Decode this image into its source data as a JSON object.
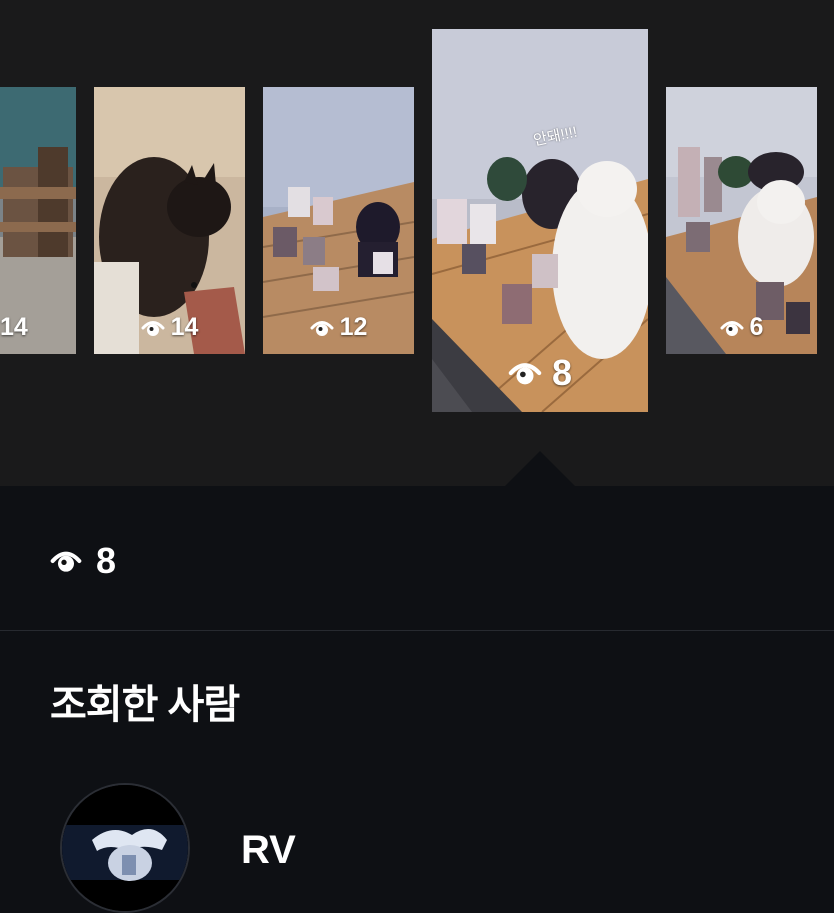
{
  "stories": [
    {
      "views": "14"
    },
    {
      "views": "14"
    },
    {
      "views": "12"
    },
    {
      "views": "8",
      "caption": "안돼!!!!"
    },
    {
      "views": "6"
    }
  ],
  "summary": {
    "views": "8"
  },
  "viewers_section": {
    "title": "조회한 사람"
  },
  "viewers": [
    {
      "name": "RV"
    }
  ],
  "icons": {
    "views": "eye-icon"
  }
}
